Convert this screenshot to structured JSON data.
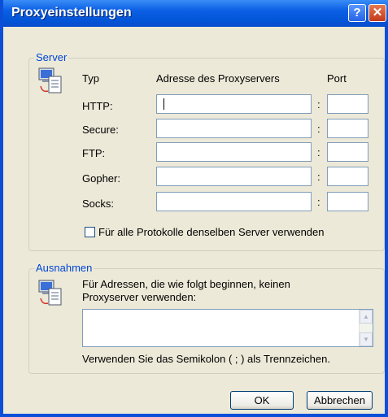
{
  "window": {
    "title": "Proxyeinstellungen"
  },
  "titlebar_buttons": {
    "help_icon": "help-icon",
    "help_glyph": "?",
    "close_icon": "close-icon",
    "close_glyph": "✕"
  },
  "server": {
    "legend": "Server",
    "icon": "computer-network-icon",
    "headers": {
      "type": "Typ",
      "address": "Adresse des Proxyservers",
      "port": "Port"
    },
    "rows": [
      {
        "label": "HTTP:",
        "address": "",
        "port": ""
      },
      {
        "label": "Secure:",
        "address": "",
        "port": ""
      },
      {
        "label": "FTP:",
        "address": "",
        "port": ""
      },
      {
        "label": "Gopher:",
        "address": "",
        "port": ""
      },
      {
        "label": "Socks:",
        "address": "",
        "port": ""
      }
    ],
    "separator": ":",
    "same_server_checkbox": {
      "label": "Für alle Protokolle denselben Server verwenden",
      "checked": false
    }
  },
  "exceptions": {
    "legend": "Ausnahmen",
    "icon": "computer-network-icon",
    "description": "Für Adressen, die wie folgt beginnen, keinen Proxyserver verwenden:",
    "textarea_value": "",
    "hint": "Verwenden Sie das Semikolon ( ; ) als Trennzeichen."
  },
  "buttons": {
    "ok": "OK",
    "cancel": "Abbrechen"
  },
  "colors": {
    "titlebar": "#0a5fe4",
    "face": "#ece9d8",
    "legend": "#0046d5",
    "close": "#c3391b"
  }
}
